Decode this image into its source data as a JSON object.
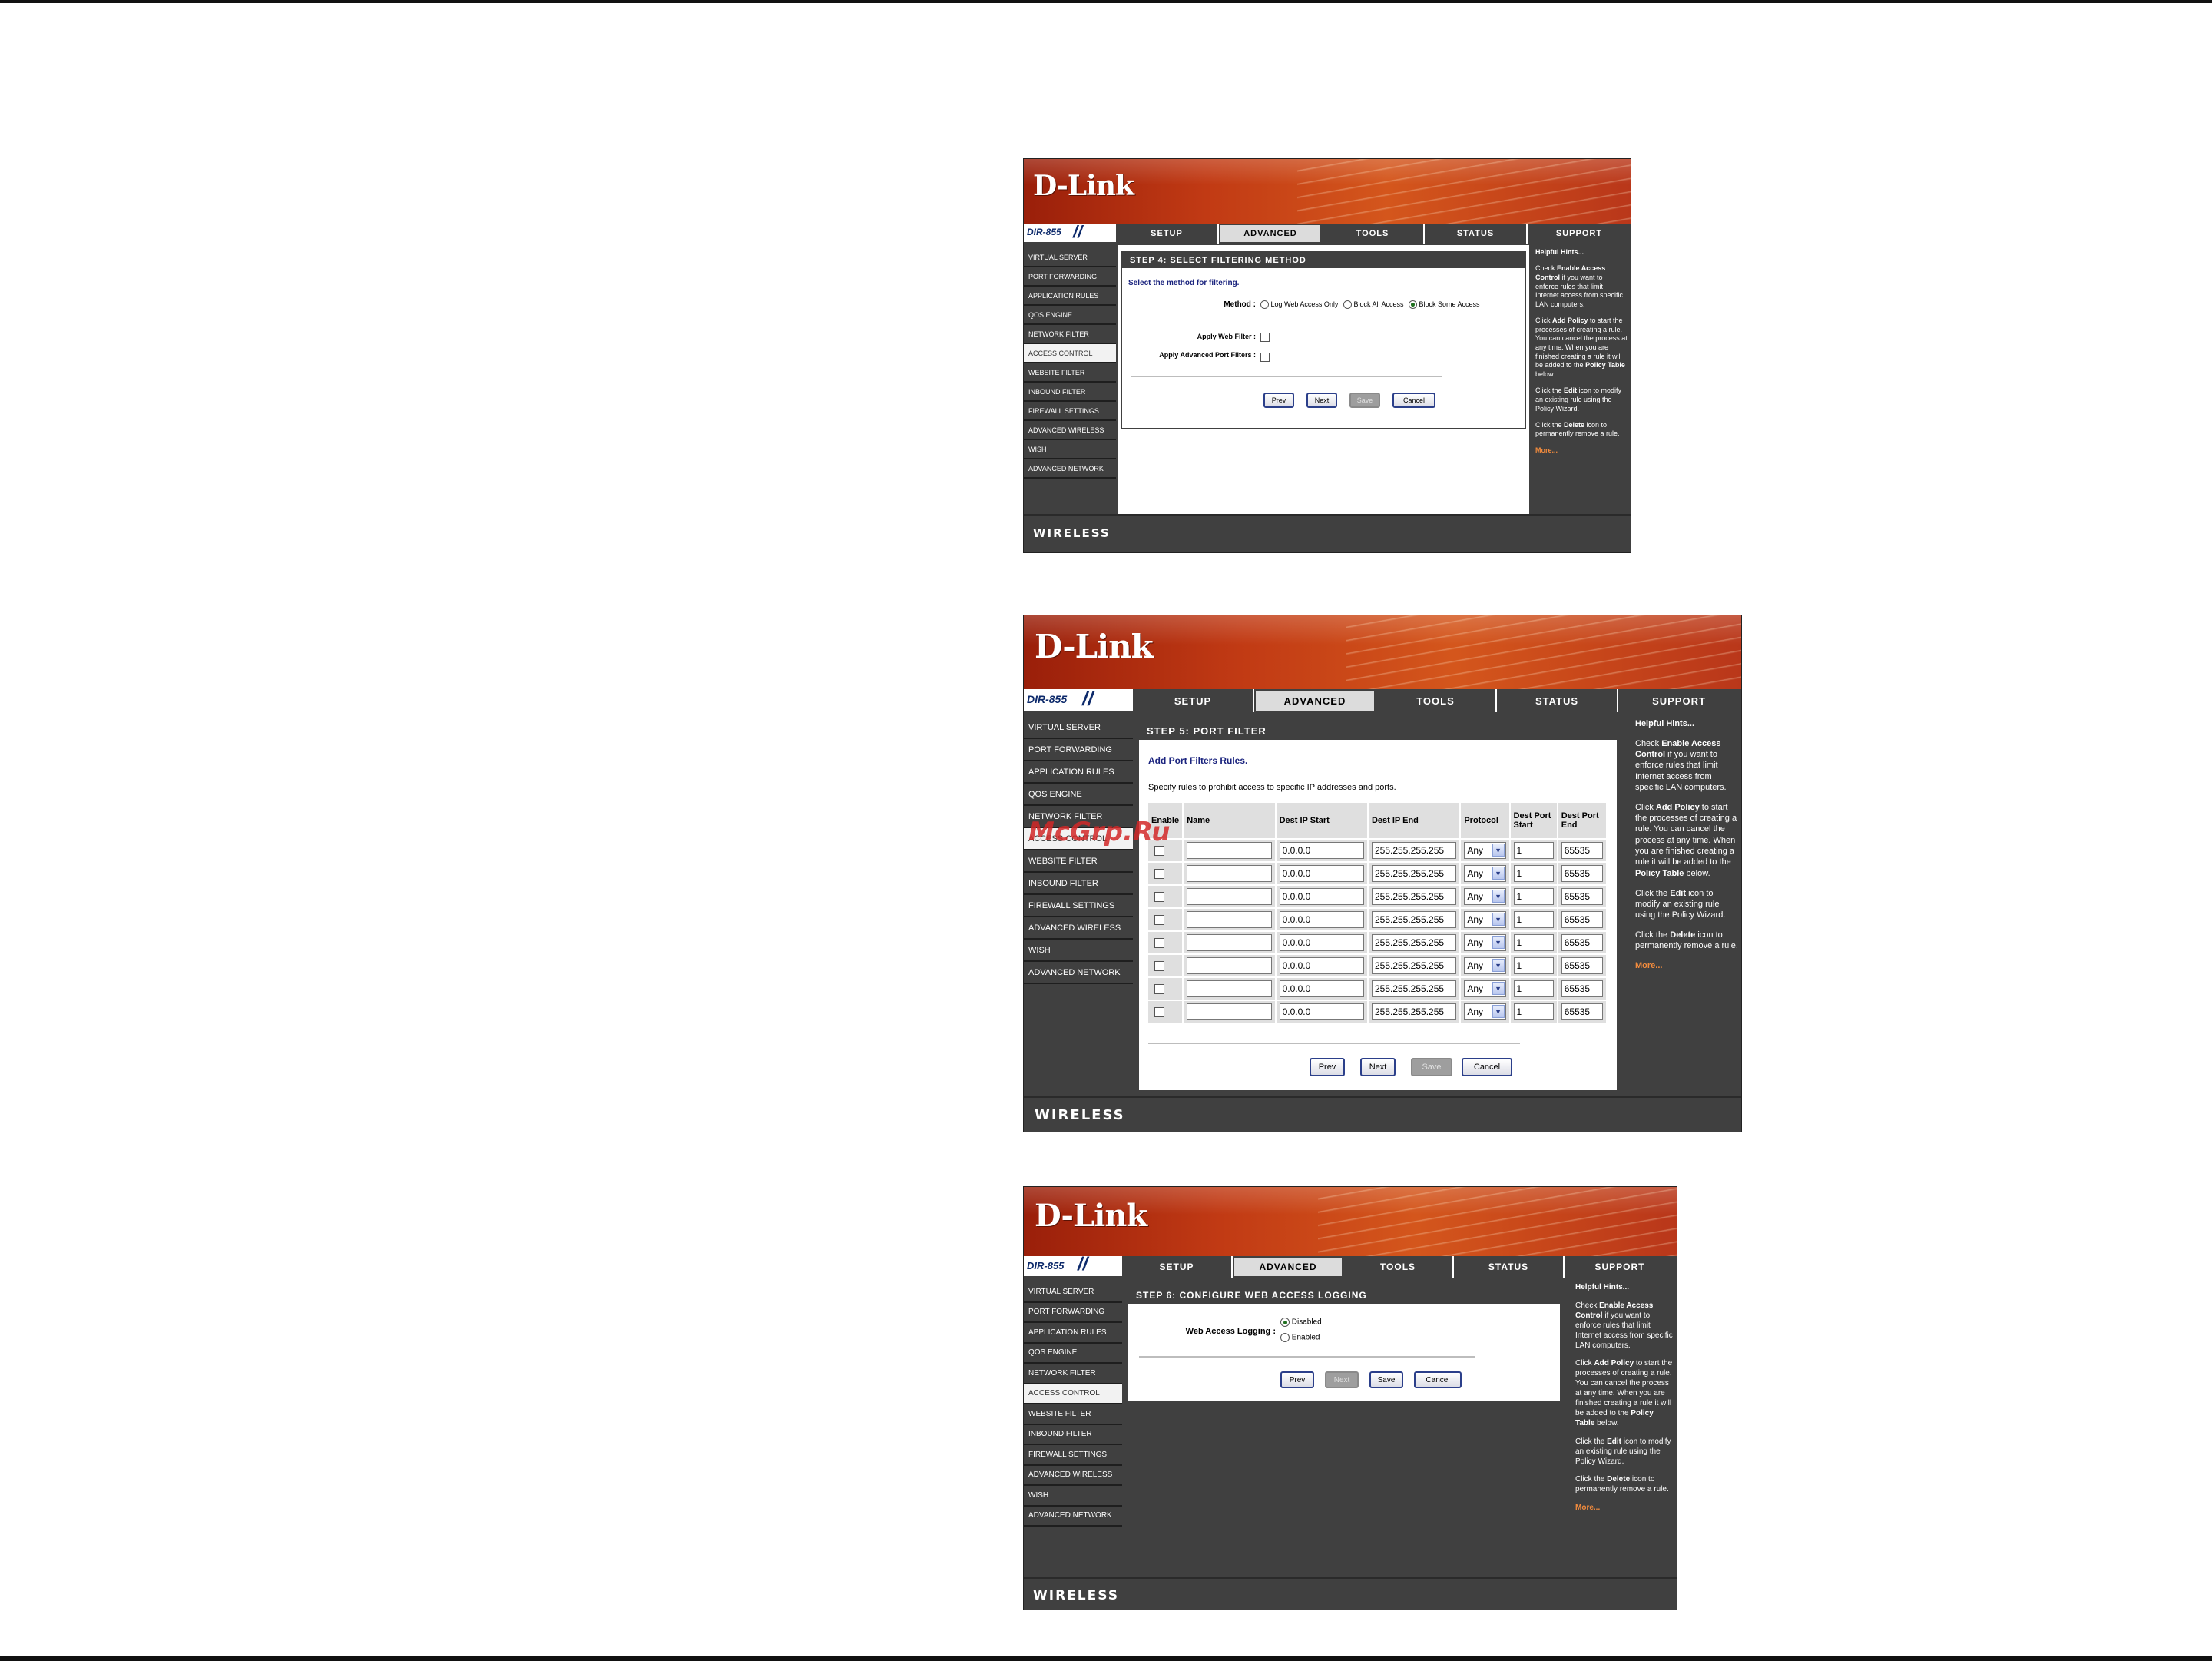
{
  "brand": {
    "logo": "D-Link",
    "model": "DIR-855",
    "footer": "WIRELESS"
  },
  "tabs": [
    "SETUP",
    "ADVANCED",
    "TOOLS",
    "STATUS",
    "SUPPORT"
  ],
  "nav": [
    "VIRTUAL SERVER",
    "PORT FORWARDING",
    "APPLICATION RULES",
    "QOS ENGINE",
    "NETWORK FILTER",
    "ACCESS CONTROL",
    "WEBSITE FILTER",
    "INBOUND FILTER",
    "FIREWALL SETTINGS",
    "ADVANCED WIRELESS",
    "WISH",
    "ADVANCED NETWORK"
  ],
  "hints": {
    "title": "Helpful Hints...",
    "p1_pre": "Check ",
    "p1_bold": "Enable Access Control",
    "p1_post": " if you want to enforce rules that limit Internet access from specific LAN computers.",
    "p2_pre": "Click ",
    "p2_bold": "Add Policy",
    "p2_post": " to start the processes of creating a rule. You can cancel the process at any time. When you are finished creating a rule it will be added to the ",
    "p2_bold2": "Policy Table",
    "p2_post2": " below.",
    "p3_pre": "Click the ",
    "p3_bold": "Edit",
    "p3_post": " icon to modify an existing rule using the Policy Wizard.",
    "p4_pre": "Click the ",
    "p4_bold": "Delete",
    "p4_post": " icon to permanently remove a rule.",
    "more": "More..."
  },
  "buttons": {
    "prev": "Prev",
    "next": "Next",
    "save": "Save",
    "cancel": "Cancel"
  },
  "step4": {
    "title": "STEP 4: SELECT FILTERING METHOD",
    "intro": "Select the method for filtering.",
    "method_label": "Method :",
    "methods": [
      "Log Web Access Only",
      "Block All Access",
      "Block Some Access"
    ],
    "web_filter_label": "Apply Web Filter :",
    "port_filter_label": "Apply Advanced Port Filters :"
  },
  "step5": {
    "title": "STEP 5: PORT FILTER",
    "heading": "Add Port Filters Rules.",
    "desc": "Specify rules to prohibit access to specific IP addresses and ports.",
    "columns": [
      "Enable",
      "Name",
      "Dest IP Start",
      "Dest IP End",
      "Protocol",
      "Dest Port Start",
      "Dest Port End"
    ],
    "rows": [
      {
        "ip_start": "0.0.0.0",
        "ip_end": "255.255.255.255",
        "protocol": "Any",
        "port_start": "1",
        "port_end": "65535"
      },
      {
        "ip_start": "0.0.0.0",
        "ip_end": "255.255.255.255",
        "protocol": "Any",
        "port_start": "1",
        "port_end": "65535"
      },
      {
        "ip_start": "0.0.0.0",
        "ip_end": "255.255.255.255",
        "protocol": "Any",
        "port_start": "1",
        "port_end": "65535"
      },
      {
        "ip_start": "0.0.0.0",
        "ip_end": "255.255.255.255",
        "protocol": "Any",
        "port_start": "1",
        "port_end": "65535"
      },
      {
        "ip_start": "0.0.0.0",
        "ip_end": "255.255.255.255",
        "protocol": "Any",
        "port_start": "1",
        "port_end": "65535"
      },
      {
        "ip_start": "0.0.0.0",
        "ip_end": "255.255.255.255",
        "protocol": "Any",
        "port_start": "1",
        "port_end": "65535"
      },
      {
        "ip_start": "0.0.0.0",
        "ip_end": "255.255.255.255",
        "protocol": "Any",
        "port_start": "1",
        "port_end": "65535"
      },
      {
        "ip_start": "0.0.0.0",
        "ip_end": "255.255.255.255",
        "protocol": "Any",
        "port_start": "1",
        "port_end": "65535"
      }
    ]
  },
  "step6": {
    "title": "STEP 6: CONFIGURE WEB ACCESS LOGGING",
    "label": "Web Access Logging :",
    "options": [
      "Disabled",
      "Enabled"
    ]
  },
  "watermark": "McGrp.Ru"
}
